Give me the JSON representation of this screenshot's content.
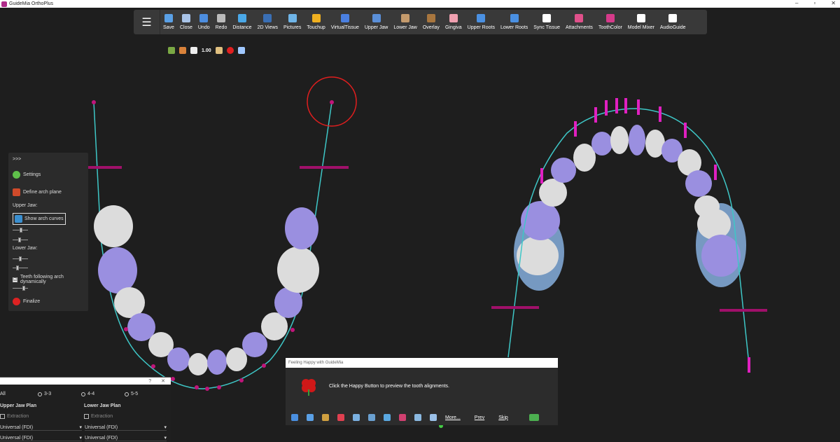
{
  "window": {
    "title": "GuideMia OrthoPlus",
    "minimize": "–",
    "maximize": "▫",
    "close": "✕"
  },
  "toolbar": {
    "menu_icon": "☰",
    "tools": [
      {
        "label": "Save",
        "icon": "floppy-icon",
        "color": "#5aa0e6"
      },
      {
        "label": "Close",
        "icon": "close-file-icon",
        "color": "#a9c4e8"
      },
      {
        "label": "Undo",
        "icon": "undo-icon",
        "color": "#4d8ee0"
      },
      {
        "label": "Redo",
        "icon": "redo-icon",
        "color": "#bbbbbb"
      },
      {
        "label": "Distance",
        "icon": "ruler-icon",
        "color": "#4aa8e8"
      },
      {
        "label": "2D Views",
        "icon": "monitor-icon",
        "color": "#3a6fb5"
      },
      {
        "label": "Pictures",
        "icon": "picture-icon",
        "color": "#6fb5e8"
      },
      {
        "label": "Touchup",
        "icon": "touchup-icon",
        "color": "#f0b020"
      },
      {
        "label": "VirtualTissue",
        "icon": "tissue-arc-icon",
        "color": "#4a7fe0"
      },
      {
        "label": "Upper Jaw",
        "icon": "upper-jaw-icon",
        "color": "#5a8fd8"
      },
      {
        "label": "Lower Jaw",
        "icon": "lower-jaw-icon",
        "color": "#c49a6c"
      },
      {
        "label": "Overlay",
        "icon": "overlay-icon",
        "color": "#a8763e"
      },
      {
        "label": "Gingiva",
        "icon": "gingiva-icon",
        "color": "#f0a0b0"
      },
      {
        "label": "Upper Roots",
        "icon": "upper-roots-icon",
        "color": "#4a90e2"
      },
      {
        "label": "Lower Roots",
        "icon": "lower-roots-icon",
        "color": "#4a90e2"
      },
      {
        "label": "Sync Tissue",
        "icon": "sync-tissue-icon",
        "color": "#ffffff"
      },
      {
        "label": "Attachments",
        "icon": "attachments-icon",
        "color": "#e0508a"
      },
      {
        "label": "ToothColor",
        "icon": "tooth-color-icon",
        "color": "#d63a8a"
      },
      {
        "label": "Model Mixer",
        "icon": "cube-icon",
        "color": "#ffffff"
      },
      {
        "label": "AudioGuide",
        "icon": "mic-off-icon",
        "color": "#ffffff"
      }
    ]
  },
  "mini_toolbar": {
    "zoom": "1.00"
  },
  "arch_panel": {
    "expand": ">>>",
    "settings": "Settings",
    "define_arch_plane": "Define arch plane",
    "upper_jaw": "Upper Jaw:",
    "show_arch_curves": "Show arch curves",
    "lower_jaw": "Lower Jaw:",
    "teeth_following": "Teeth following arch dynamically",
    "teeth_following_checked": "☑",
    "finalize": "Finalize"
  },
  "plan_panel": {
    "help": "?",
    "close": "✕",
    "radio_all": "All",
    "radio_33": "3-3",
    "radio_44": "4-4",
    "radio_55": "5-5",
    "upper_title": "Upper Jaw Plan",
    "lower_title": "Lower Jaw Plan",
    "upper_extraction": "Extraction",
    "lower_extraction": "Extraction",
    "upper_sel1": "Universal (FDI)",
    "upper_sel2": "Universal (FDI)",
    "lower_sel1": "Universal (FDI)",
    "lower_sel2": "Universal (FDI)"
  },
  "happy_dialog": {
    "title": "Feeling Happy with GuideMia",
    "message": "Click the Happy Button to preview the tooth alignments.",
    "more": "More...",
    "prev": "Prev",
    "skip": "Skip"
  },
  "colors": {
    "arch_curve": "#3ec7c7",
    "marker": "#c0157a",
    "tooth_white": "#dcdcdc",
    "tooth_purple": "#9a8fe0",
    "tooth_blue": "#8cb8ea",
    "attachment": "#e020c0",
    "selection_ring": "#e01e1e"
  }
}
